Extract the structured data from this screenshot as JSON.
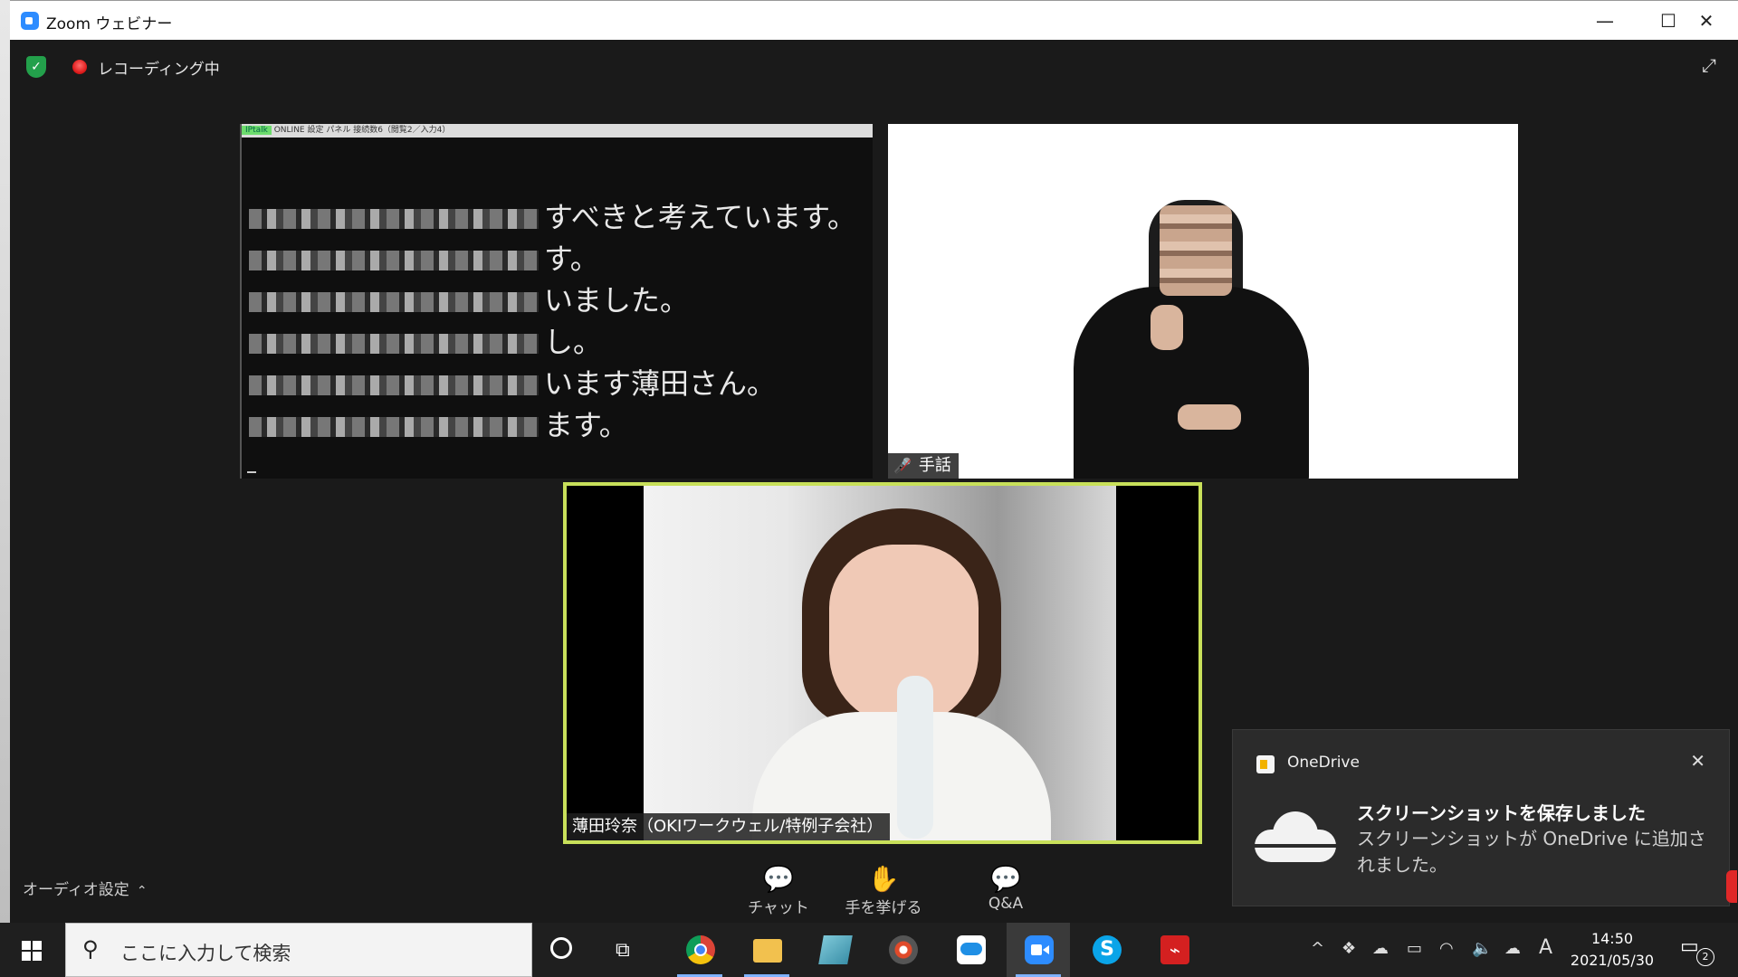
{
  "window": {
    "title": "Zoom ウェビナー",
    "minimize": "—",
    "maximize": "☐",
    "close": "✕"
  },
  "topbar": {
    "recording_label": "レコーディング中"
  },
  "caption_panel": {
    "toolbar_text": "ONLINE 設定 パネル 接続数6（閲覧2／入力4）",
    "lines": [
      "すべきと考えています。",
      "す。",
      "いました。",
      "し。",
      "います薄田さん。",
      "ます。"
    ]
  },
  "sign_tile": {
    "name": "手話"
  },
  "speaker_tile": {
    "name": "薄田玲奈（OKIワークウェル/特例子会社）"
  },
  "controls": {
    "audio_settings": "オーディオ設定",
    "chat": "チャット",
    "raise_hand": "手を挙げる",
    "qa": "Q&A"
  },
  "toast": {
    "app": "OneDrive",
    "heading": "スクリーンショットを保存しました",
    "body": "スクリーンショットが OneDrive に追加されました。"
  },
  "taskbar": {
    "search_placeholder": "ここに入力して検索",
    "time": "14:50",
    "date": "2021/05/30",
    "ime": "A",
    "notifications": "2"
  },
  "colors": {
    "active_speaker_border": "#c8e05a",
    "recording": "#e02020",
    "security_green": "#23a04b",
    "zoom_blue": "#2d8cff"
  }
}
